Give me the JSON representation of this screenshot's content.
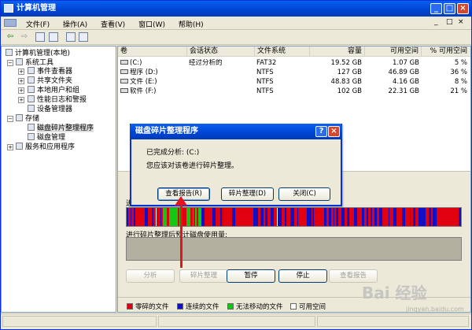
{
  "window": {
    "title": "计算机管理",
    "minimize": "_",
    "maximize": "□",
    "close": "×"
  },
  "menu": [
    "文件(F)",
    "操作(A)",
    "查看(V)",
    "窗口(W)",
    "帮助(H)"
  ],
  "menu_extra": {
    "minimize": "_",
    "restore": "□",
    "close": "×"
  },
  "tree": {
    "root": "计算机管理(本地)",
    "system_tools": "系统工具",
    "event_viewer": "事件查看器",
    "shared_folders": "共享文件夹",
    "local_users": "本地用户和组",
    "perf_logs": "性能日志和警报",
    "device_manager": "设备管理器",
    "storage": "存储",
    "defrag": "磁盘碎片整理程序",
    "disk_mgmt": "磁盘管理",
    "services": "服务和应用程序"
  },
  "columns": [
    "卷",
    "会话状态",
    "文件系统",
    "容量",
    "可用空间",
    "% 可用空间"
  ],
  "volumes": [
    {
      "name": "(C:)",
      "status": "经过分析的",
      "fs": "FAT32",
      "capacity": "19.52 GB",
      "free": "1.07 GB",
      "pct": "5 %"
    },
    {
      "name": "程序 (D:)",
      "status": "",
      "fs": "NTFS",
      "capacity": "127 GB",
      "free": "46.89 GB",
      "pct": "36 %"
    },
    {
      "name": "文件 (E:)",
      "status": "",
      "fs": "NTFS",
      "capacity": "48.83 GB",
      "free": "4.16 GB",
      "pct": "8 %"
    },
    {
      "name": "软件 (F:)",
      "status": "",
      "fs": "NTFS",
      "capacity": "102 GB",
      "free": "22.31 GB",
      "pct": "21 %"
    }
  ],
  "lower": {
    "est_label_start": "进",
    "after_label": "进行碎片整理后预计磁盘使用量:",
    "buttons": {
      "analyze": "分析",
      "defrag": "碎片整理",
      "pause": "暂停",
      "stop": "停止",
      "report": "查看报告"
    }
  },
  "legend": {
    "fragmented": "零碎的文件",
    "contiguous": "连续的文件",
    "unmovable": "无法移动的文件",
    "free": "可用空间"
  },
  "colors": {
    "fragmented": "#e00010",
    "contiguous": "#1010c8",
    "unmovable": "#12c812",
    "free": "#ffffff"
  },
  "dialog": {
    "title": "磁盘碎片整理程序",
    "help": "?",
    "close": "×",
    "line1": "已完成分析: (C:)",
    "line2": "您应该对该卷进行碎片整理。",
    "view_report": "查看报告(R)",
    "defragment": "碎片整理(D)",
    "close_btn": "关闭(C)"
  },
  "watermark": {
    "main": "Bai 经验",
    "sub": "jingyan.baidu.com"
  }
}
